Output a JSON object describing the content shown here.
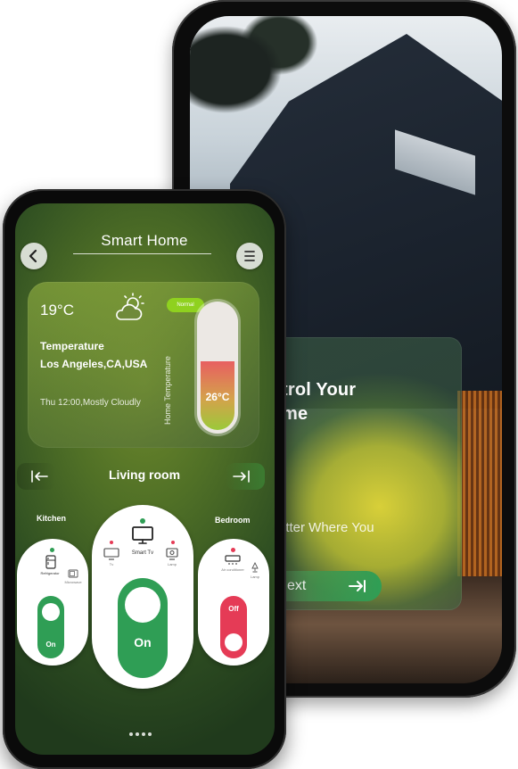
{
  "onboarding": {
    "title_line1": "trol Your",
    "title_line2": "me",
    "subtitle": "atter Where You",
    "next_label": "ext"
  },
  "app": {
    "title": "Smart Home"
  },
  "weather": {
    "temperature": "19°C",
    "label": "Temperature",
    "city": "Los Angeles,CA,USA",
    "status": "Thu 12:00,Mostly Cloudly",
    "badge": "Normal",
    "home_temp_label": "Home Temperature",
    "home_temp_value": "26°C",
    "home_temp_fill_fraction": 0.55
  },
  "rooms": {
    "current": "Living room",
    "left": "Kitchen",
    "right": "Bedroom"
  },
  "devices": {
    "kitchen": {
      "item1": "Refrigerator",
      "item2": "Microwave",
      "toggle": "On"
    },
    "living": {
      "item_main": "Smart Tv",
      "item_left": "Tv",
      "item_right": "Lamp",
      "toggle": "On"
    },
    "bedroom": {
      "item1": "Air conditioner",
      "item2": "Lamp",
      "toggle": "Off"
    }
  },
  "colors": {
    "accent_green": "#2f9e55",
    "off_red": "#e53b56",
    "badge_green": "#8fd11f"
  },
  "pager": {
    "count": 4
  }
}
